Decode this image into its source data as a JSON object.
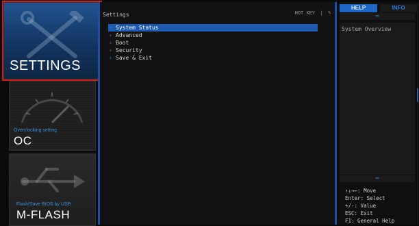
{
  "tiles": {
    "settings": {
      "title": "SETTINGS",
      "icon": "wrench-hammer-icon"
    },
    "oc": {
      "subtitle": "Overclocking setting",
      "title": "OC",
      "icon": "gauge-icon"
    },
    "mflash": {
      "subtitle": "Flash/Save BIOS by USB",
      "title": "M-FLASH",
      "icon": "usb-icon"
    }
  },
  "center": {
    "title": "Settings",
    "hotkey_label": "HOT KEY",
    "hotkey_sep": "|",
    "hotkey_icon": "back-arrow-icon",
    "hotkey_glyph": "↰",
    "menu": [
      {
        "label": "System Status",
        "selected": true
      },
      {
        "label": "Advanced",
        "selected": false
      },
      {
        "label": "Boot",
        "selected": false
      },
      {
        "label": "Security",
        "selected": false
      },
      {
        "label": "Save & Exit",
        "selected": false
      }
    ]
  },
  "help": {
    "tabs": {
      "help": "HELP",
      "info": "INFO"
    },
    "body_text": "System Overview",
    "scroll_up_glyph": "═",
    "scroll_down_glyph": "═",
    "keys": [
      "↑↓→←: Move",
      "Enter: Select",
      "+/-: Value",
      "ESC: Exit",
      "F1: General Help"
    ]
  },
  "colors": {
    "accent_blue": "#1e5bb0",
    "highlight_red": "#d21b1b",
    "subtitle_blue": "#3d8fd8"
  }
}
